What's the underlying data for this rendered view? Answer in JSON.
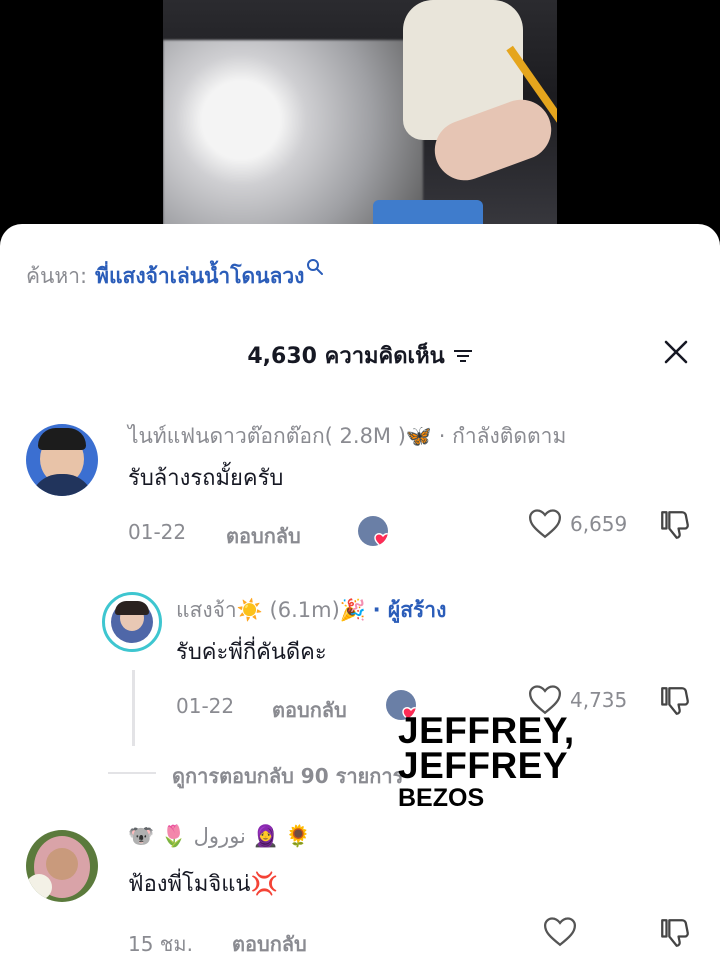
{
  "search": {
    "prefix": "ค้นหา:",
    "query": "พี่แสงจ้าเล่นน้ำโดนลวง"
  },
  "header": {
    "count_label": "4,630 ความคิดเห็น"
  },
  "comments": [
    {
      "username": "ไนท์แฟนดาวต๊อกต๊อก( 2.8M )🦋",
      "tag": "· กำลังติดตาม",
      "text": "รับล้างรถมั้ยครับ",
      "date": "01-22",
      "reply_label": "ตอบกลับ",
      "likes": "6,659",
      "replies": [
        {
          "username": "แสงจ้า☀️ (6.1m)🎉",
          "tag": "· ผู้สร้าง",
          "text": "รับค่ะพี่กี่คันดีคะ",
          "date": "01-22",
          "reply_label": "ตอบกลับ",
          "likes": "4,735"
        }
      ],
      "view_replies_label": "ดูการตอบกลับ 90 รายการ"
    },
    {
      "username": "🐨 🌷 نورول 🧕 🌻",
      "text": "ฟ้องพี่โมจิแน่💢",
      "date": "15 ชม.",
      "reply_label": "ตอบกลับ"
    }
  ],
  "overlay": {
    "line1": "JEFFREY,",
    "line2": "JEFFREY",
    "line3": "BEZOS"
  },
  "colors": {
    "link_blue": "#2b5db9",
    "muted_gray": "#8a8b91",
    "heart_red": "#fe2c55",
    "text_dark": "#161823"
  },
  "icons": [
    "search-icon",
    "filter-icon",
    "close-icon",
    "heart-icon",
    "dislike-icon"
  ]
}
